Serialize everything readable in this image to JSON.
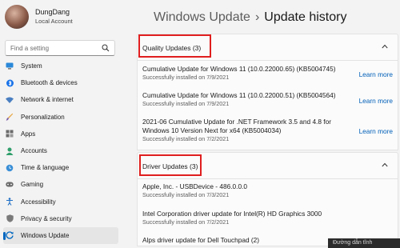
{
  "profile": {
    "name": "DungDang",
    "account": "Local Account"
  },
  "search": {
    "placeholder": "Find a setting"
  },
  "nav": {
    "items": [
      {
        "label": "System",
        "icon": "monitor-icon"
      },
      {
        "label": "Bluetooth & devices",
        "icon": "bluetooth-icon"
      },
      {
        "label": "Network & internet",
        "icon": "wifi-icon"
      },
      {
        "label": "Personalization",
        "icon": "paint-brush-icon"
      },
      {
        "label": "Apps",
        "icon": "apps-icon"
      },
      {
        "label": "Accounts",
        "icon": "person-icon"
      },
      {
        "label": "Time & language",
        "icon": "globe-clock-icon"
      },
      {
        "label": "Gaming",
        "icon": "gamepad-icon"
      },
      {
        "label": "Accessibility",
        "icon": "accessibility-icon"
      },
      {
        "label": "Privacy & security",
        "icon": "shield-icon"
      },
      {
        "label": "Windows Update",
        "icon": "windows-update-icon",
        "active": true
      }
    ]
  },
  "header": {
    "crumb": "Windows Update",
    "separator": "›",
    "title": "Update history"
  },
  "quality": {
    "title": "Quality Updates (3)",
    "items": [
      {
        "title": "Cumulative Update for Windows 11 (10.0.22000.65) (KB5004745)",
        "status": "Successfully installed on 7/9/2021",
        "link": "Learn more"
      },
      {
        "title": "Cumulative Update for Windows 11 (10.0.22000.51) (KB5004564)",
        "status": "Successfully installed on 7/9/2021",
        "link": "Learn more"
      },
      {
        "title": "2021-06 Cumulative Update for .NET Framework 3.5 and 4.8 for",
        "title2": "Windows 10 Version Next for x64 (KB5004034)",
        "status": "Successfully installed on 7/2/2021",
        "link": "Learn more"
      }
    ]
  },
  "driver": {
    "title": "Driver Updates (3)",
    "items": [
      {
        "title": "Apple, Inc. - USBDevice - 486.0.0.0",
        "status": "Successfully installed on 7/3/2021"
      },
      {
        "title": "Intel Corporation driver update for Intel(R) HD Graphics 3000",
        "status": "Successfully installed on 7/2/2021"
      },
      {
        "title": "Alps driver update for Dell Touchpad (2)"
      }
    ]
  },
  "tooltip": {
    "text": "Đường dẫn tĩnh"
  },
  "colors": {
    "accent": "#0067c0",
    "link": "#005fb8",
    "highlight": "#e01e1e"
  }
}
